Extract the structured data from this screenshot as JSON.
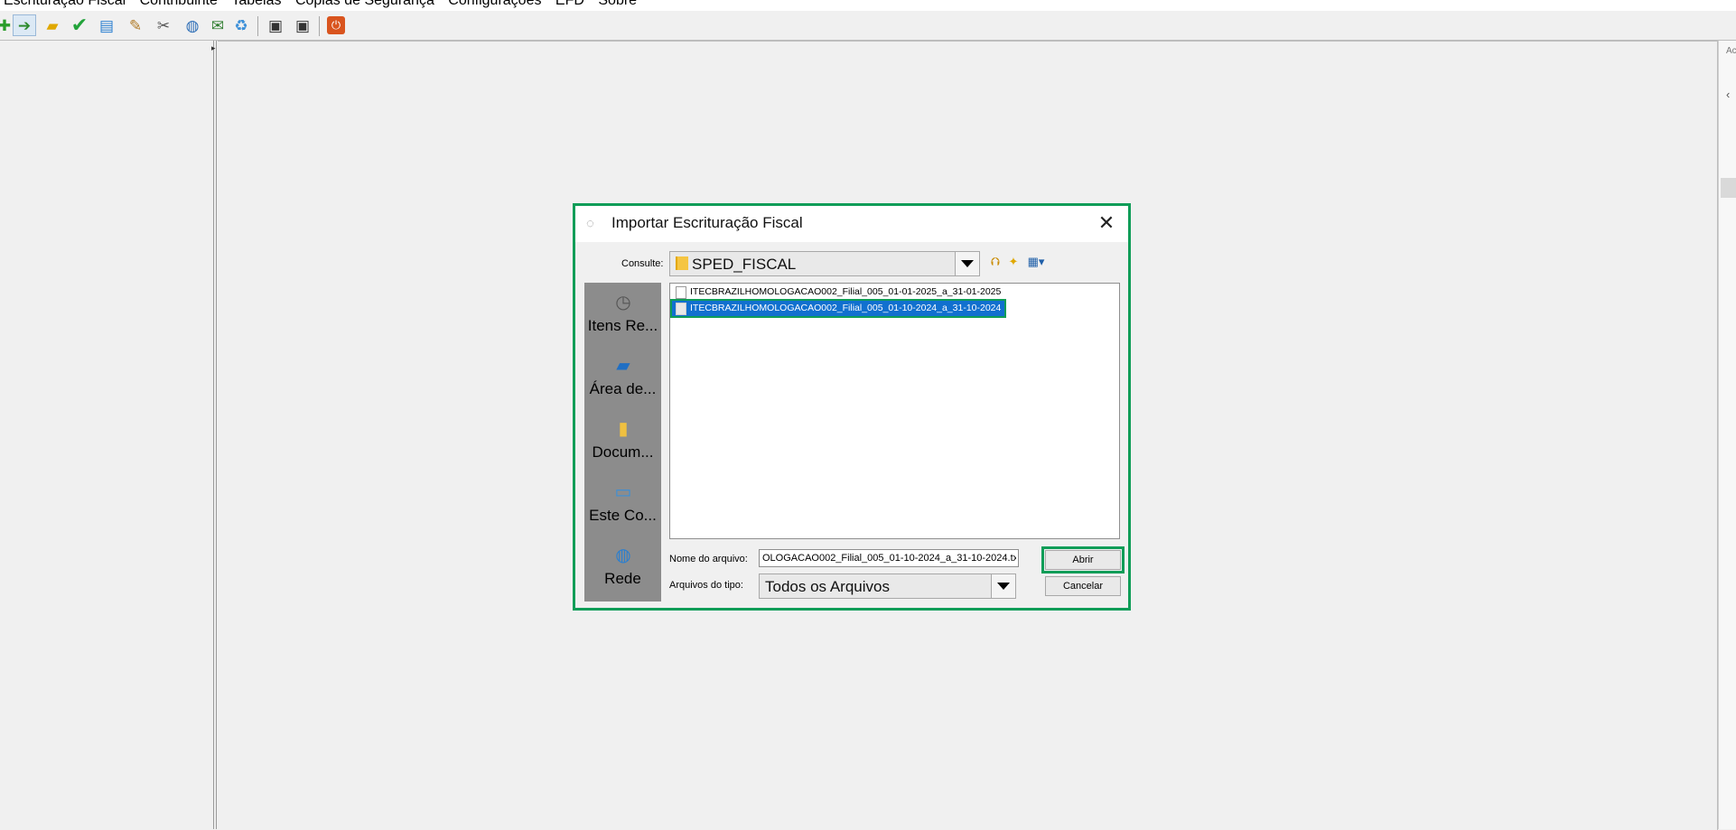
{
  "menu": {
    "items": [
      "Escrituração Fiscal",
      "Contribuinte",
      "Tabelas",
      "Cópias de Segurança",
      "Configurações",
      "EFD",
      "Sobre"
    ]
  },
  "toolbar": {
    "icons": [
      "new-icon",
      "import-icon",
      "open-folder-icon",
      "validate-check-icon",
      "export-icon",
      "edit-sign-icon",
      "tools-icon",
      "globe-transmit-icon",
      "receipt-icon",
      "recycle-icon",
      "save-icon",
      "save-as-icon",
      "exit-icon"
    ]
  },
  "right_strip": {
    "label": "Ac",
    "arrow": "‹"
  },
  "dialog": {
    "title": "Importar Escrituração Fiscal",
    "close_label": "✕",
    "look_in_label": "Consulte:",
    "look_in_value": "SPED_FISCAL",
    "places": [
      {
        "label": "Itens Re...",
        "icon": "recent-items-icon"
      },
      {
        "label": "Área de...",
        "icon": "desktop-icon"
      },
      {
        "label": "Docum...",
        "icon": "documents-icon"
      },
      {
        "label": "Este Co...",
        "icon": "computer-icon"
      },
      {
        "label": "Rede",
        "icon": "network-icon"
      }
    ],
    "files": [
      {
        "name": "ITECBRAZILHOMOLOGACAO002_Filial_005_01-01-2025_a_31-01-2025",
        "selected": false
      },
      {
        "name": "ITECBRAZILHOMOLOGACAO002_Filial_005_01-10-2024_a_31-10-2024",
        "selected": true
      }
    ],
    "filename_label": "Nome do arquivo:",
    "filename_value": "OLOGACAO002_Filial_005_01-10-2024_a_31-10-2024.txt",
    "filetype_label": "Arquivos do tipo:",
    "filetype_value": "Todos os Arquivos",
    "open_button": "Abrir",
    "cancel_button": "Cancelar"
  },
  "colors": {
    "highlight_border": "#0f9d58",
    "selection": "#1170cf",
    "places_bg": "#8c8c8c"
  }
}
